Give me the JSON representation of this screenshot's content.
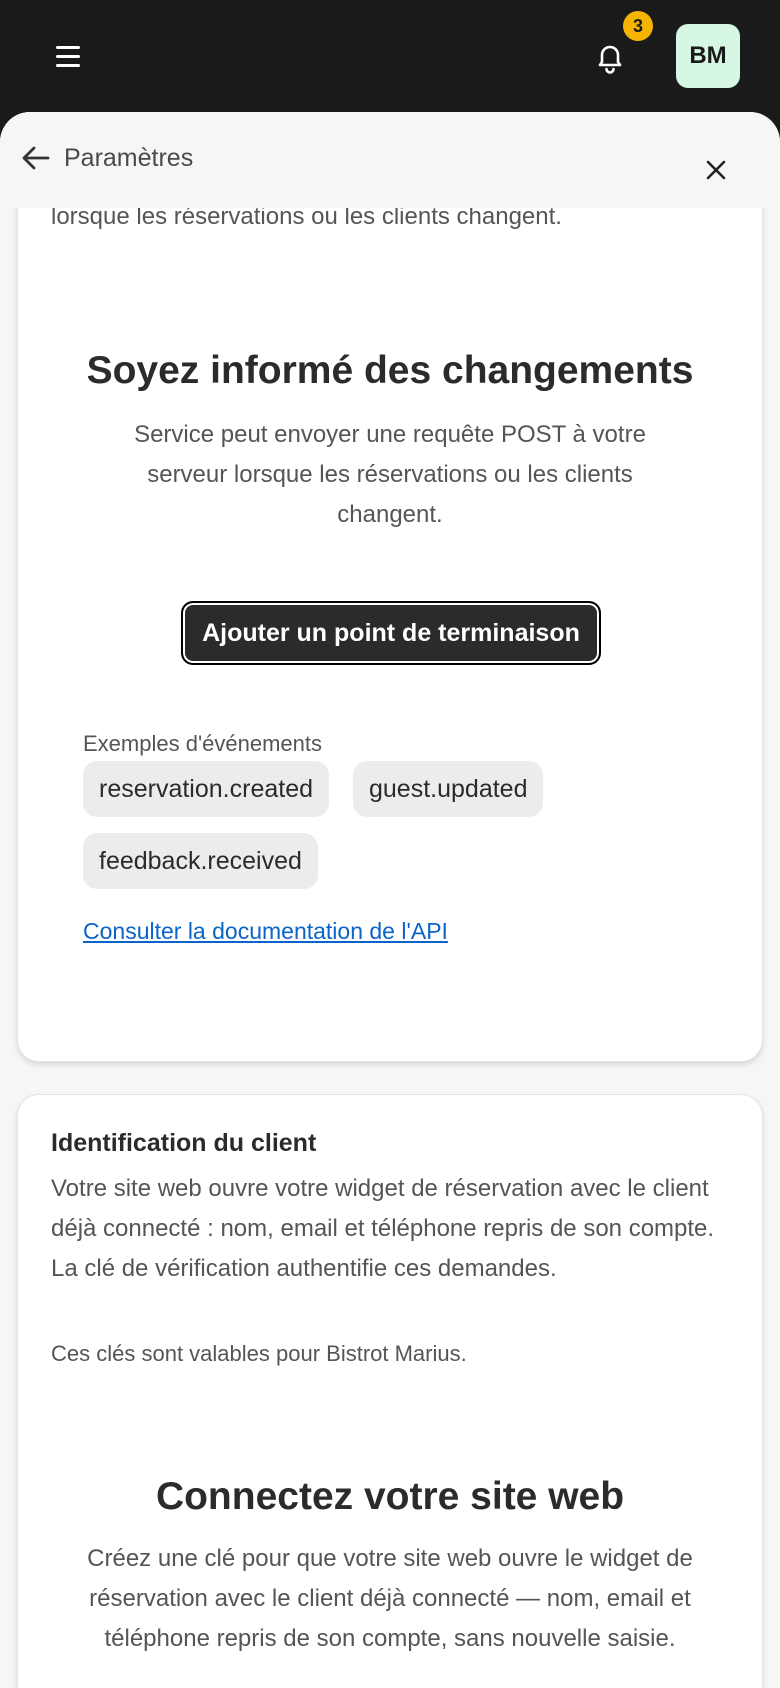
{
  "topbar": {
    "notifications_count": "3",
    "avatar_initials": "BM"
  },
  "sheet": {
    "title": "Paramètres"
  },
  "webhooks": {
    "intro_text": "Service peut envoyer une requête POST à votre serveur lorsque les réservations ou les clients changent.",
    "empty_title": "Soyez informé des changements",
    "empty_description": "Service peut envoyer une requête POST à votre serveur lorsque les réservations ou les clients changent.",
    "add_button_label": "Ajouter un point de terminaison",
    "events_label": "Exemples d'événements",
    "events": [
      "reservation.created",
      "guest.updated",
      "feedback.received"
    ],
    "docs_link": "Consulter la documentation de l'API"
  },
  "identity": {
    "title": "Identification du client",
    "description": "Votre site web ouvre votre widget de réservation avec le client déjà connecté : nom, email et téléphone repris de son compte. La clé de vérification authentifie ces demandes.",
    "note": "Ces clés sont valables pour Bistrot Marius.",
    "empty_title": "Connectez votre site web",
    "empty_description": "Créez une clé pour que votre site web ouvre le widget de réservation avec le client déjà connecté — nom, email et téléphone repris de son compte, sans nouvelle saisie."
  },
  "icons": {
    "menu": "menu-icon",
    "notifications": "bell-icon",
    "back": "arrow-left-icon",
    "close": "close-icon"
  },
  "colors": {
    "topbar_bg": "#1a1a1a",
    "badge": "#f5b400",
    "avatar_bg": "#d6f7e3",
    "link": "#0a64c9",
    "primary_button": "#2b2b2b"
  }
}
